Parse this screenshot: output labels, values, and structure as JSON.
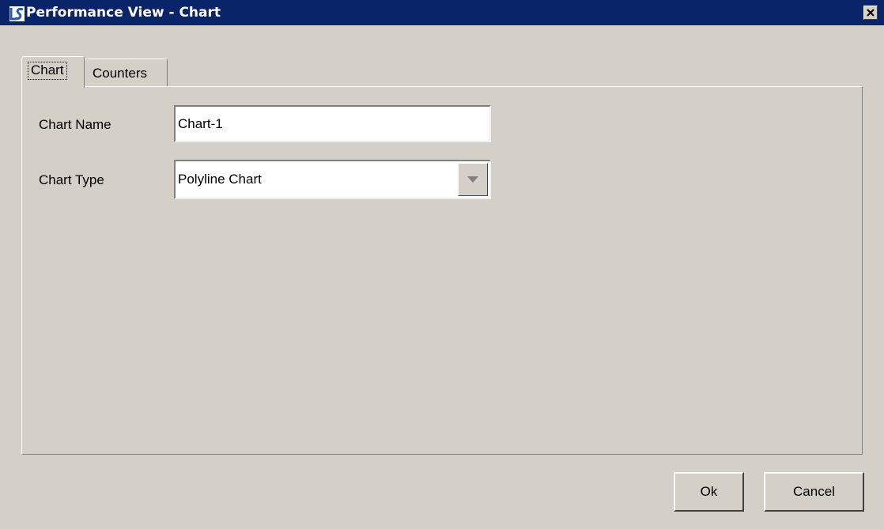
{
  "window": {
    "title": "Performance View - Chart",
    "icon": "application-icon",
    "close_icon": "close-icon"
  },
  "tabs": [
    {
      "label": "Chart",
      "selected": true
    },
    {
      "label": "Counters",
      "selected": false
    }
  ],
  "form": {
    "chart_name": {
      "label": "Chart Name",
      "value": "Chart-1"
    },
    "chart_type": {
      "label": "Chart Type",
      "value": "Polyline Chart",
      "dropdown_icon": "chevron-down-icon"
    }
  },
  "buttons": {
    "ok": "Ok",
    "cancel": "Cancel"
  },
  "colors": {
    "title_bar": "#0a246a",
    "window_background": "#d4d0c8",
    "field_background": "#ffffff"
  }
}
